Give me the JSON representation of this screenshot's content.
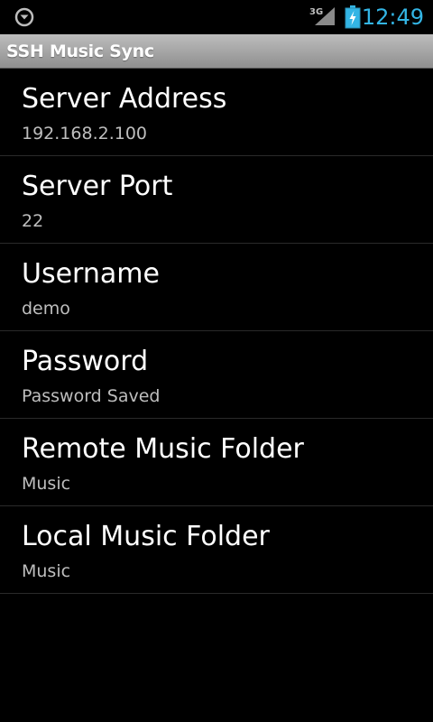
{
  "status_bar": {
    "network_type": "3G",
    "time": "12:49",
    "icons": [
      "notification-download-icon",
      "signal-3g-icon",
      "battery-charging-icon"
    ]
  },
  "app": {
    "title": "SSH Music Sync"
  },
  "preferences": [
    {
      "title": "Server Address",
      "summary": "192.168.2.100"
    },
    {
      "title": "Server Port",
      "summary": "22"
    },
    {
      "title": "Username",
      "summary": "demo"
    },
    {
      "title": "Password",
      "summary": "Password Saved"
    },
    {
      "title": "Remote Music Folder",
      "summary": "Music"
    },
    {
      "title": "Local Music Folder",
      "summary": "Music"
    }
  ],
  "colors": {
    "background": "#000000",
    "clock": "#33b5e5",
    "title_bar": "#a8a8a8",
    "summary_text": "#bebebe",
    "divider": "#2a2a2a"
  }
}
